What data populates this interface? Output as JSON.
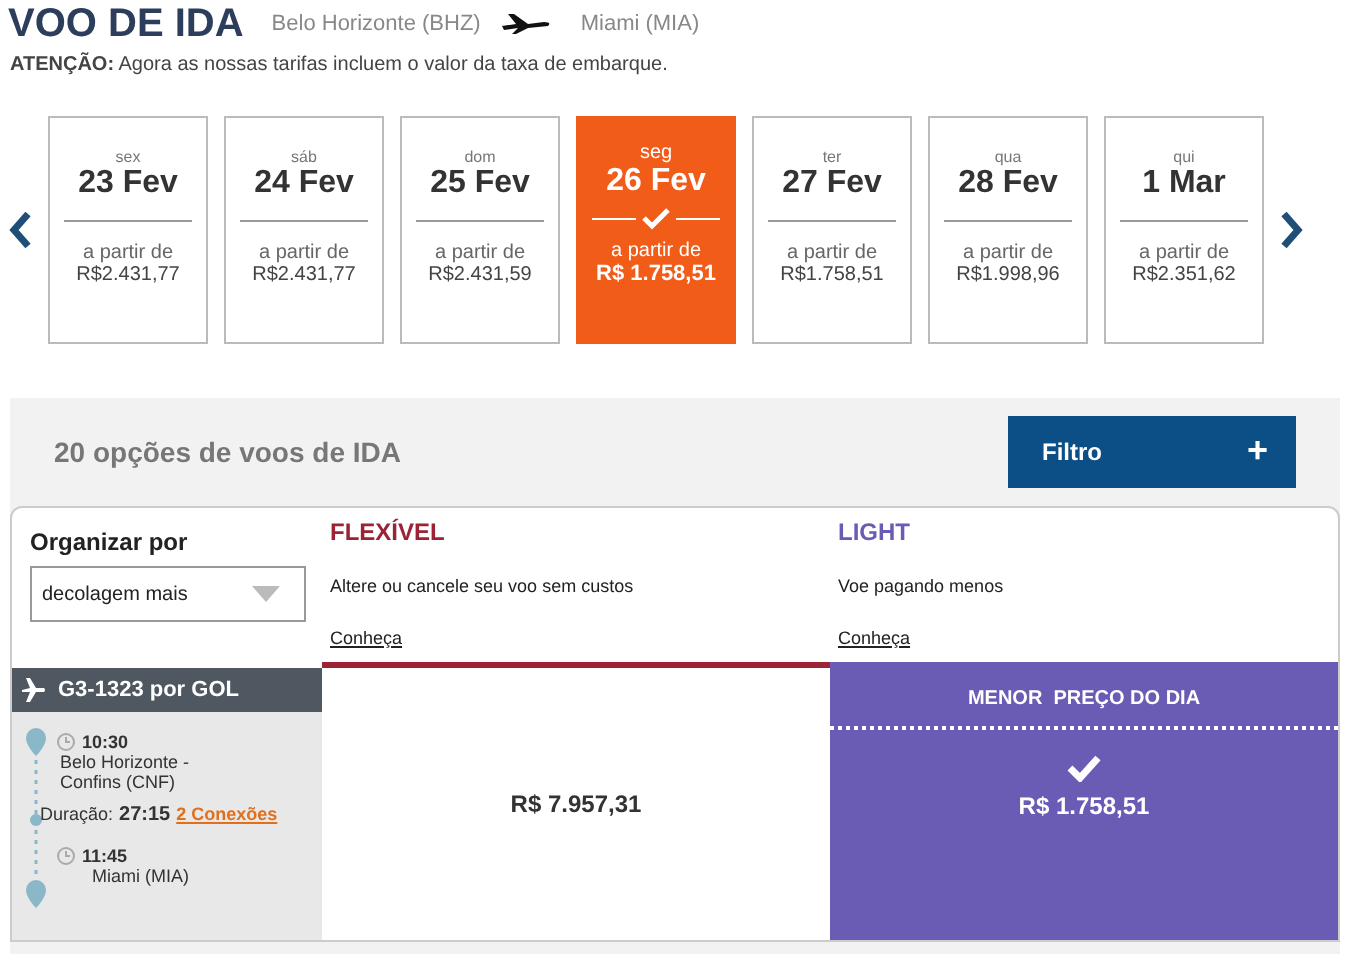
{
  "header": {
    "title": "VOO DE IDA",
    "origin": "Belo Horizonte  (BHZ)",
    "destination": "Miami  (MIA)",
    "notice_label": "ATENÇÃO:",
    "notice": "Agora as nossas tarifas incluem o valor da taxa de embarque."
  },
  "dates": [
    {
      "weekday": "sex",
      "date": "23 Fev",
      "from_label": "a partir de",
      "price": "R$2.431,77",
      "selected": false
    },
    {
      "weekday": "sáb",
      "date": "24 Fev",
      "from_label": "a partir de",
      "price": "R$2.431,77",
      "selected": false
    },
    {
      "weekday": "dom",
      "date": "25 Fev",
      "from_label": "a partir de",
      "price": "R$2.431,59",
      "selected": false
    },
    {
      "weekday": "seg",
      "date": "26 Fev",
      "from_label": "a partir de",
      "price": "R$ 1.758,51",
      "selected": true
    },
    {
      "weekday": "ter",
      "date": "27 Fev",
      "from_label": "a partir de",
      "price": "R$1.758,51",
      "selected": false
    },
    {
      "weekday": "qua",
      "date": "28 Fev",
      "from_label": "a partir de",
      "price": "R$1.998,96",
      "selected": false
    },
    {
      "weekday": "qui",
      "date": "1 Mar",
      "from_label": "a partir de",
      "price": "R$2.351,62",
      "selected": false
    }
  ],
  "results": {
    "title": "20 opções de voos de IDA",
    "filter_button": "Filtro",
    "filter_icon": "+"
  },
  "sort": {
    "label": "Organizar por",
    "value": "decolagem mais"
  },
  "fares": [
    {
      "name": "FLEXÍVEL",
      "color": "#9b2335",
      "description": "Altere ou cancele seu voo sem custos",
      "link": "Conheça",
      "price": "R$ 7.957,31",
      "selected": false
    },
    {
      "name": "LIGHT",
      "color": "#6a5bb5",
      "description": "Voe pagando menos",
      "link": "Conheça",
      "badge": "MENOR  PREÇO DO DIA",
      "price": "R$ 1.758,51",
      "selected": true
    }
  ],
  "flight": {
    "code": "G3-1323 por  GOL",
    "departure_time": "10:30",
    "departure_place": "Belo Horizonte - Confins (CNF)",
    "duration_label": "Duração:",
    "duration": "27:15",
    "connections": "2 Conexões",
    "arrival_time": "11:45",
    "arrival_place": "Miami (MIA)"
  }
}
